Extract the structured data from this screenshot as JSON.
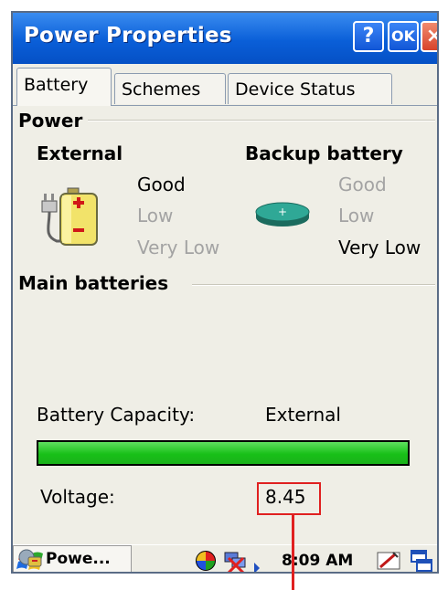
{
  "window": {
    "title": "Power Properties",
    "help_label": "?",
    "ok_label": "OK",
    "close_label": "×"
  },
  "tabs": [
    {
      "label": "Battery",
      "selected": true
    },
    {
      "label": "Schemes",
      "selected": false
    },
    {
      "label": "Device Status",
      "selected": false
    }
  ],
  "power": {
    "section_label": "Power",
    "external": {
      "heading": "External",
      "levels": [
        "Good",
        "Low",
        "Very Low"
      ],
      "active_level": "Good"
    },
    "backup": {
      "heading": "Backup battery",
      "levels": [
        "Good",
        "Low",
        "Very Low"
      ],
      "active_level": "Very Low"
    }
  },
  "main_batteries": {
    "section_label": "Main batteries",
    "capacity_label": "Battery Capacity:",
    "capacity_value": "External",
    "capacity_fraction": 1.0,
    "voltage_label": "Voltage:",
    "voltage_value": "8.45"
  },
  "taskbar": {
    "task_label": "Powe...",
    "clock": "8:09 AM"
  },
  "colors": {
    "titlebar": "#0a5fd8",
    "bar_fill": "#18c018",
    "highlight": "#e02020",
    "dim_text": "#a3a3a3"
  }
}
